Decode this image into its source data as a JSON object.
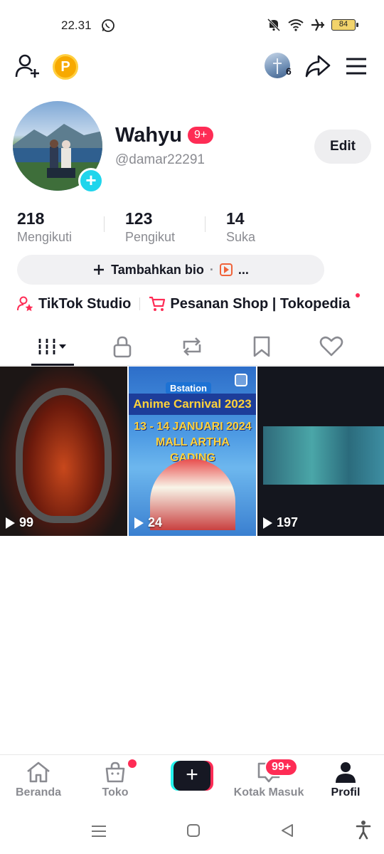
{
  "status_bar": {
    "time": "22.31",
    "battery": "84"
  },
  "profile": {
    "username": "Wahyu",
    "notification_badge": "9+",
    "handle": "@damar22291",
    "edit_label": "Edit",
    "story_count": "6",
    "coin_letter": "P"
  },
  "stats": [
    {
      "value": "218",
      "label": "Mengikuti"
    },
    {
      "value": "123",
      "label": "Pengikut"
    },
    {
      "value": "14",
      "label": "Suka"
    }
  ],
  "bio": {
    "label": "Tambahkan bio",
    "separator": "·",
    "more": "..."
  },
  "links": [
    {
      "label": "TikTok Studio"
    },
    {
      "label": "Pesanan Shop | Tokopedia"
    }
  ],
  "tabs": [
    "videos",
    "private",
    "reposts",
    "saved",
    "liked"
  ],
  "videos": [
    {
      "views": "99"
    },
    {
      "views": "24",
      "title_logo": "Bstation",
      "title": "Anime Carnival 2023",
      "date_line1": "13 - 14 JANUARI 2024",
      "date_line2": "MALL ARTHA GADING"
    },
    {
      "views": "197"
    }
  ],
  "bottom_nav": {
    "home": "Beranda",
    "shop": "Toko",
    "inbox": "Kotak Masuk",
    "inbox_badge": "99+",
    "profile": "Profil",
    "create_symbol": "+"
  },
  "colors": {
    "accent": "#fe2c55",
    "cyan": "#20d5ec",
    "coin": "#f7a900"
  }
}
